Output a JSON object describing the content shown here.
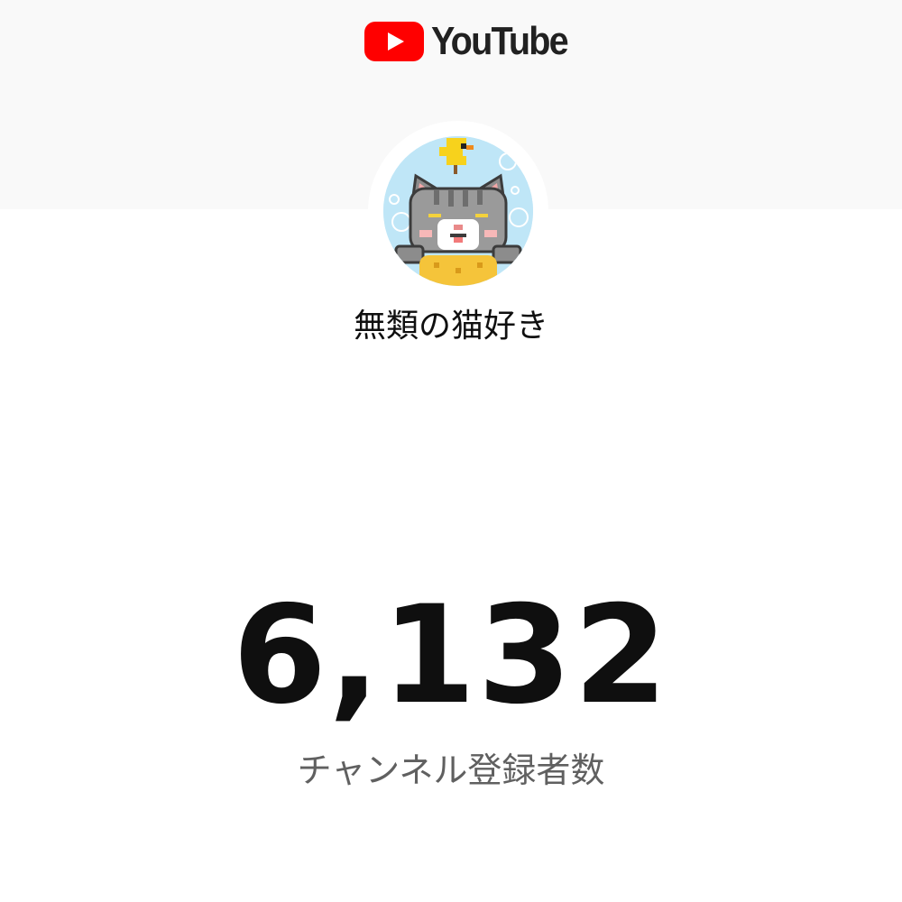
{
  "header": {
    "logo_text": "YouTube",
    "logo_icon": "youtube-play-icon",
    "brand_color": "#FF0000",
    "background_color": "#F9F9F9"
  },
  "channel": {
    "name": "無類の猫好き",
    "avatar": "pixel-cat-with-bird-avatar"
  },
  "subscribers": {
    "count": "6,132",
    "label": "チャンネル登録者数"
  }
}
